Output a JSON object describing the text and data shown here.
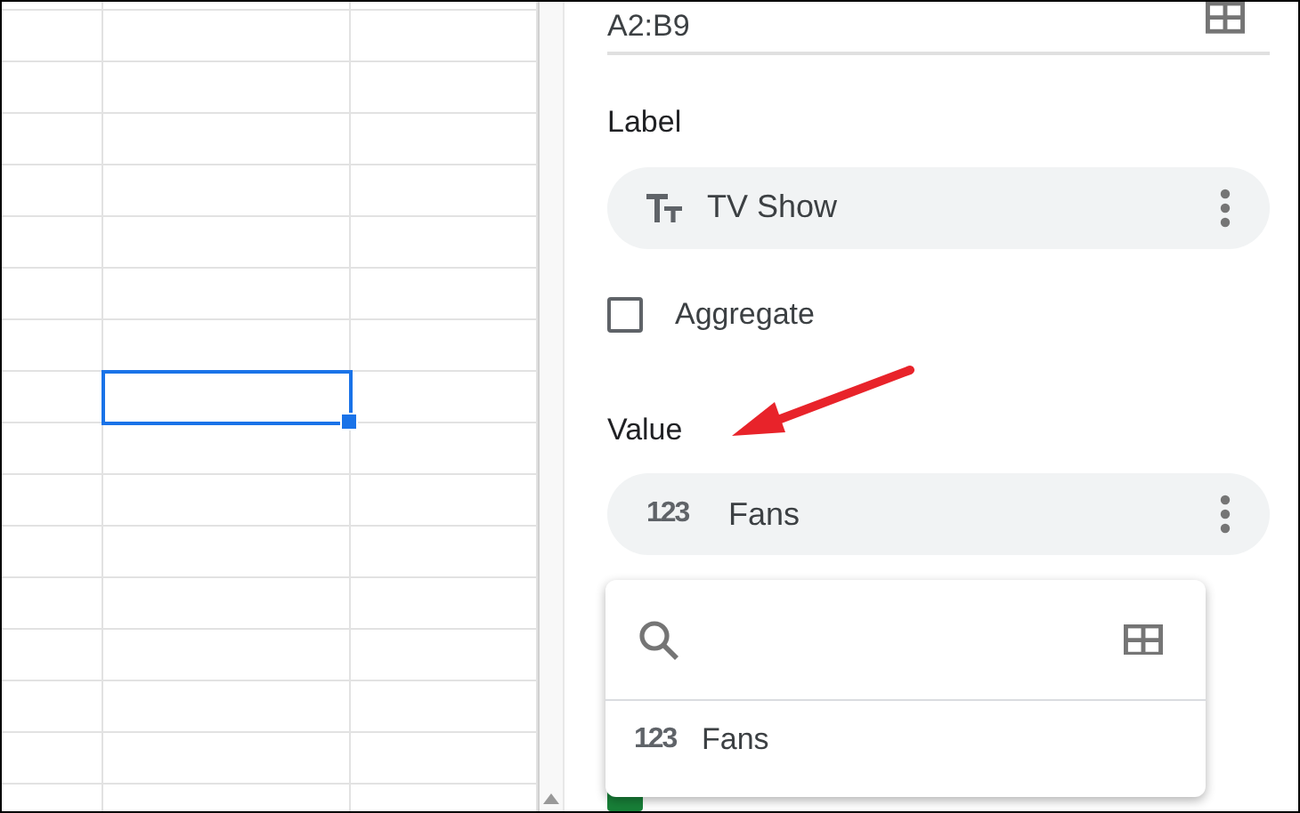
{
  "sheet": {
    "rows": [
      {
        "cells": [
          {
            "selected": false
          },
          {
            "selected": false
          },
          {
            "selected": false
          }
        ]
      },
      {
        "cells": [
          {
            "selected": false
          },
          {
            "selected": false
          },
          {
            "selected": false
          }
        ]
      },
      {
        "cells": [
          {
            "selected": false
          },
          {
            "selected": false
          },
          {
            "selected": false
          }
        ]
      },
      {
        "cells": [
          {
            "selected": false
          },
          {
            "selected": false
          },
          {
            "selected": false
          }
        ]
      },
      {
        "cells": [
          {
            "selected": false
          },
          {
            "selected": false
          },
          {
            "selected": false
          }
        ]
      },
      {
        "cells": [
          {
            "selected": false
          },
          {
            "selected": false
          },
          {
            "selected": false
          }
        ]
      },
      {
        "cells": [
          {
            "selected": false
          },
          {
            "selected": false
          },
          {
            "selected": false
          }
        ]
      },
      {
        "cells": [
          {
            "selected": false
          },
          {
            "selected": false
          },
          {
            "selected": false
          }
        ]
      },
      {
        "cells": [
          {
            "selected": false
          },
          {
            "selected": true
          },
          {
            "selected": false
          }
        ]
      },
      {
        "cells": [
          {
            "selected": false
          },
          {
            "selected": false
          },
          {
            "selected": false
          }
        ]
      },
      {
        "cells": [
          {
            "selected": false
          },
          {
            "selected": false
          },
          {
            "selected": false
          }
        ]
      },
      {
        "cells": [
          {
            "selected": false
          },
          {
            "selected": false
          },
          {
            "selected": false
          }
        ]
      },
      {
        "cells": [
          {
            "selected": false
          },
          {
            "selected": false
          },
          {
            "selected": false
          }
        ]
      },
      {
        "cells": [
          {
            "selected": false
          },
          {
            "selected": false
          },
          {
            "selected": false
          }
        ]
      },
      {
        "cells": [
          {
            "selected": false
          },
          {
            "selected": false
          },
          {
            "selected": false
          }
        ]
      },
      {
        "cells": [
          {
            "selected": false
          },
          {
            "selected": false
          },
          {
            "selected": false
          }
        ]
      },
      {
        "cells": [
          {
            "selected": false
          },
          {
            "selected": false
          },
          {
            "selected": false
          }
        ]
      }
    ]
  },
  "panel": {
    "data_range": "A2:B9",
    "label": {
      "heading": "Label",
      "field": {
        "kind": "text",
        "name": "TV Show"
      }
    },
    "aggregate": {
      "label": "Aggregate",
      "checked": false
    },
    "value": {
      "heading": "Value",
      "field": {
        "kind": "number",
        "glyph": "123",
        "name": "Fans"
      }
    },
    "dropdown": {
      "items": [
        {
          "glyph": "123",
          "name": "Fans"
        }
      ]
    },
    "use_column_labels": {
      "checked": true
    }
  }
}
